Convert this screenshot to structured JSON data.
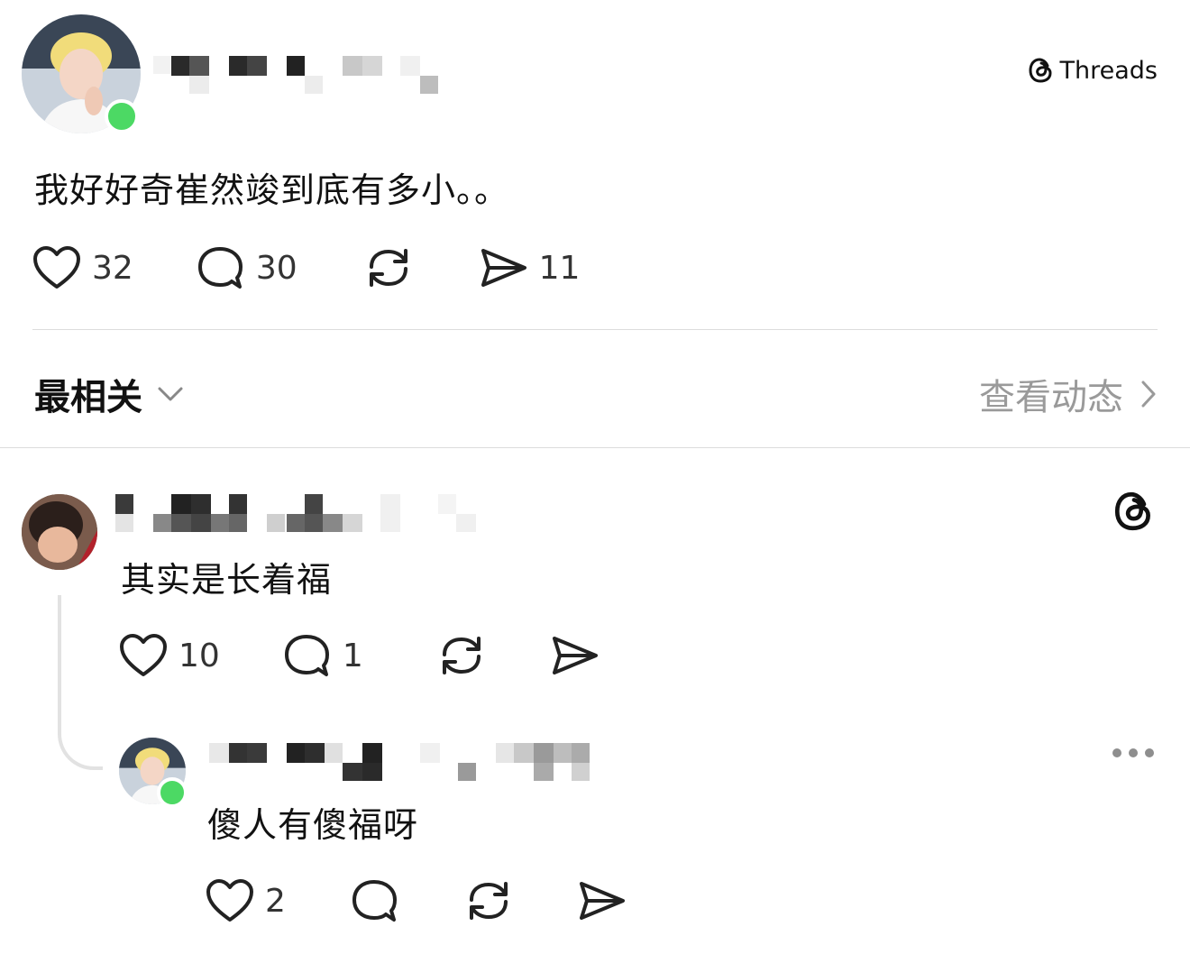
{
  "brand": {
    "name": "Threads"
  },
  "post": {
    "text": "我好好奇崔然竣到底有多小。。",
    "likes": "32",
    "comments": "30",
    "shares": "11"
  },
  "sort": {
    "label": "最相关",
    "view_activity": "查看动态"
  },
  "replies": [
    {
      "text": "其实是长着福",
      "likes": "10",
      "comments": "1"
    },
    {
      "text": "傻人有傻福呀",
      "likes": "2"
    }
  ],
  "colors": {
    "online": "#4cd964",
    "muted": "#9a9a9a",
    "divider": "#dcdcdc"
  }
}
